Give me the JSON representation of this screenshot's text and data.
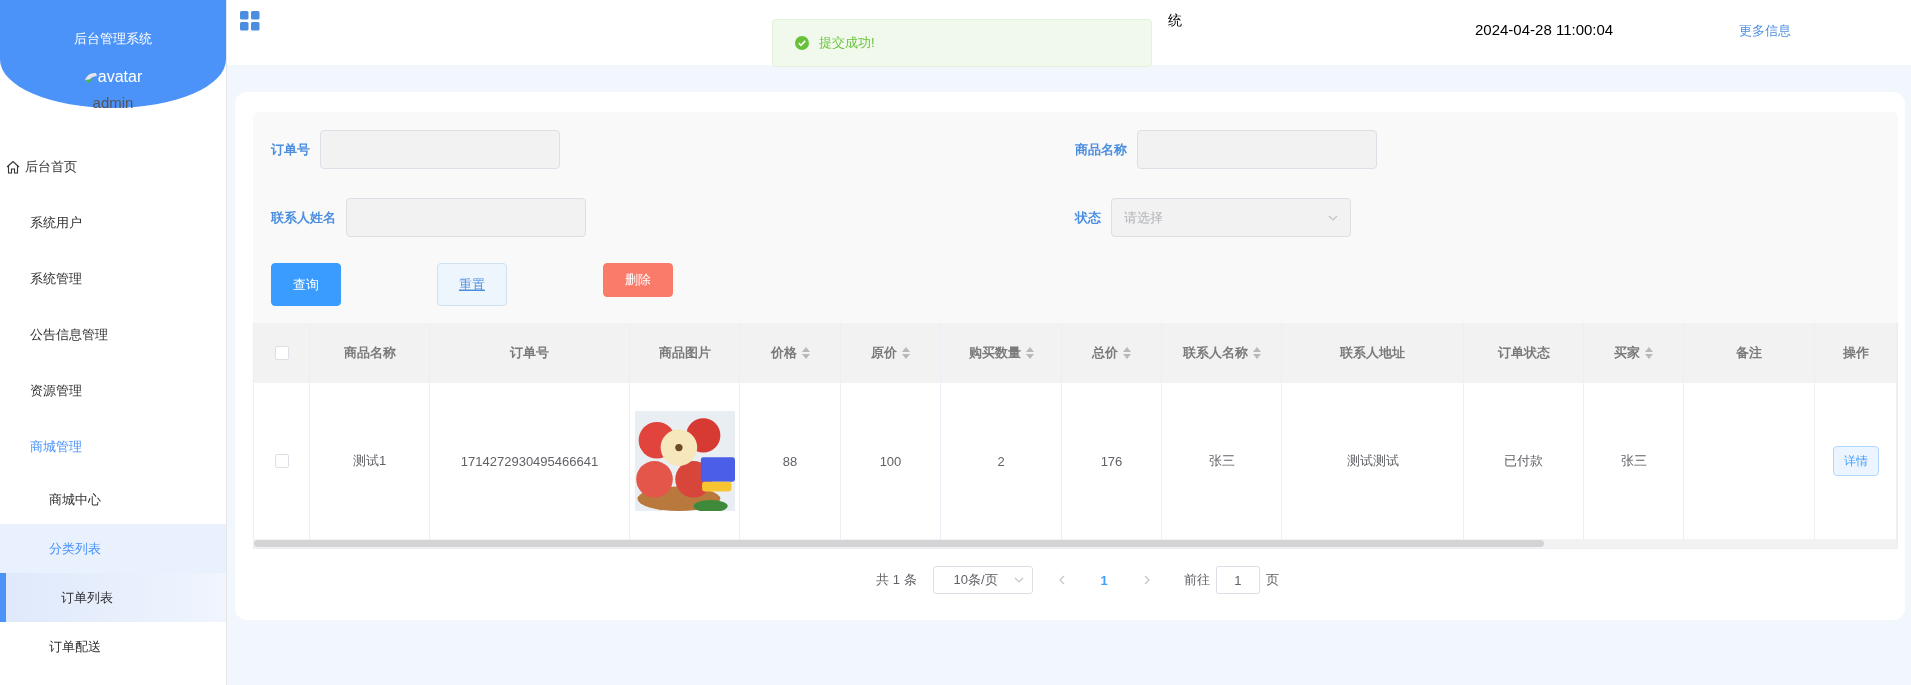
{
  "sidebar": {
    "title": "后台管理系统",
    "avatar_alt": "avatar",
    "username": "admin",
    "items": [
      {
        "label": "后台首页",
        "kind": "home",
        "expanded": false
      },
      {
        "label": "系统用户",
        "kind": "plain",
        "expanded": false
      },
      {
        "label": "系统管理",
        "kind": "plain",
        "expanded": false
      },
      {
        "label": "公告信息管理",
        "kind": "plain",
        "expanded": false
      },
      {
        "label": "资源管理",
        "kind": "plain",
        "expanded": false
      },
      {
        "label": "商城管理",
        "kind": "plain",
        "expanded": true,
        "children": [
          {
            "label": "商城中心",
            "selected": false,
            "hovered": false
          },
          {
            "label": "分类列表",
            "selected": false,
            "hovered": true
          },
          {
            "label": "订单列表",
            "selected": true,
            "hovered": false
          },
          {
            "label": "订单配送",
            "selected": false,
            "hovered": false
          }
        ]
      }
    ]
  },
  "header": {
    "title_fragment": "统",
    "datetime": "2024-04-28 11:00:04",
    "more_link": "更多信息"
  },
  "toast": {
    "kind": "success",
    "message": "提交成功!"
  },
  "filters": [
    {
      "label": "订单号",
      "kind": "input"
    },
    {
      "label": "商品名称",
      "kind": "input"
    },
    {
      "label": "联系人姓名",
      "kind": "input"
    },
    {
      "label": "状态",
      "kind": "select",
      "placeholder": "请选择"
    }
  ],
  "buttons": [
    {
      "label": "查询",
      "kind": "primary"
    },
    {
      "label": "重置",
      "kind": "plain"
    },
    {
      "label": "删除",
      "kind": "danger"
    }
  ],
  "table": {
    "header_checked": false,
    "columns": [
      {
        "label": "商品名称",
        "sortable": false
      },
      {
        "label": "订单号",
        "sortable": false
      },
      {
        "label": "商品图片",
        "sortable": false
      },
      {
        "label": "价格",
        "sortable": true
      },
      {
        "label": "原价",
        "sortable": true
      },
      {
        "label": "购买数量",
        "sortable": true
      },
      {
        "label": "总价",
        "sortable": true
      },
      {
        "label": "联系人名称",
        "sortable": true
      },
      {
        "label": "联系人地址",
        "sortable": false
      },
      {
        "label": "订单状态",
        "sortable": false
      },
      {
        "label": "买家",
        "sortable": true
      },
      {
        "label": "备注",
        "sortable": false
      },
      {
        "label": "操作",
        "sortable": false
      }
    ],
    "rows": [
      {
        "checked": false,
        "cells": [
          {
            "kind": "text",
            "text": "测试1"
          },
          {
            "kind": "text",
            "text": "1714272930495466641"
          },
          {
            "kind": "picture"
          },
          {
            "kind": "text",
            "text": "88"
          },
          {
            "kind": "text",
            "text": "100"
          },
          {
            "kind": "text",
            "text": "2"
          },
          {
            "kind": "text",
            "text": "176"
          },
          {
            "kind": "text",
            "text": "张三"
          },
          {
            "kind": "text",
            "text": "测试测试"
          },
          {
            "kind": "text",
            "text": "已付款"
          },
          {
            "kind": "text",
            "text": "张三"
          },
          {
            "kind": "empty"
          },
          {
            "kind": "button",
            "text": "详情"
          }
        ]
      }
    ]
  },
  "pagination": {
    "total": "共 1 条",
    "page_size": "10条/页",
    "pages": [
      {
        "label": "1",
        "selected": true
      }
    ],
    "goto_label": "前往",
    "goto_value": "1",
    "goto_suffix": "页"
  }
}
